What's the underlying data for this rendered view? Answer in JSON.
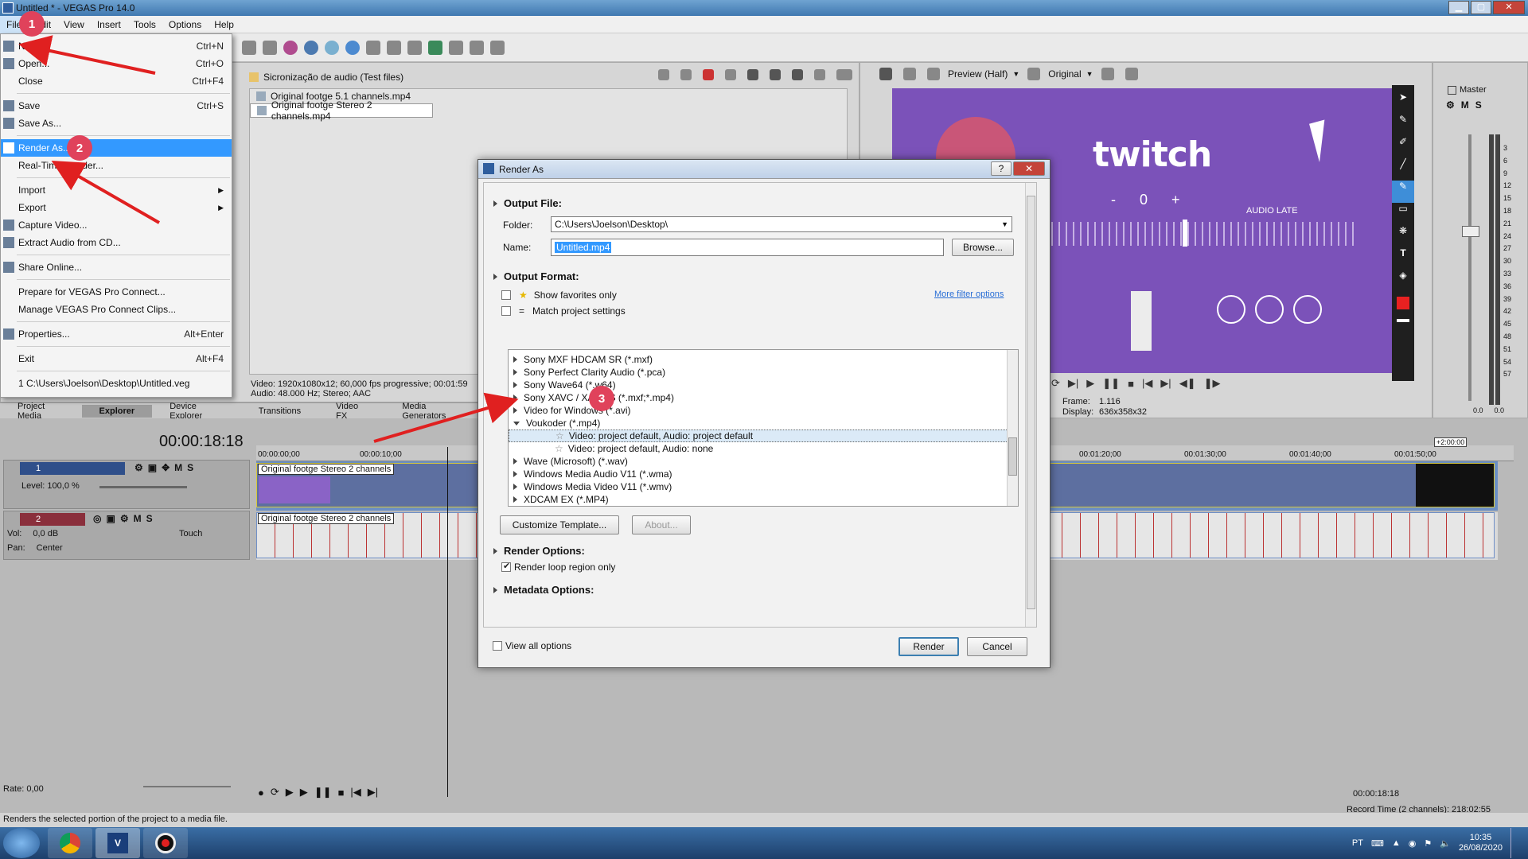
{
  "window": {
    "title": "Untitled * - VEGAS Pro 14.0"
  },
  "menubar": {
    "items": [
      "File",
      "Edit",
      "View",
      "Insert",
      "Tools",
      "Options",
      "Help"
    ]
  },
  "file_menu": {
    "items": [
      {
        "label": "New...",
        "shortcut": "Ctrl+N",
        "icon": "new-icon"
      },
      {
        "label": "Open...",
        "shortcut": "Ctrl+O",
        "icon": "open-icon"
      },
      {
        "label": "Close",
        "shortcut": "Ctrl+F4"
      },
      {
        "sep": true
      },
      {
        "label": "Save",
        "shortcut": "Ctrl+S",
        "icon": "save-icon"
      },
      {
        "label": "Save As...",
        "shortcut": "",
        "icon": "save-as-icon"
      },
      {
        "sep": true
      },
      {
        "label": "Render As...",
        "shortcut": "",
        "icon": "render-icon",
        "selected": true
      },
      {
        "label": "Real-Time Render...",
        "shortcut": ""
      },
      {
        "sep": true
      },
      {
        "label": "Import",
        "shortcut": "",
        "submenu": true
      },
      {
        "label": "Export",
        "shortcut": "",
        "submenu": true
      },
      {
        "label": "Capture Video...",
        "shortcut": "",
        "icon": "capture-icon"
      },
      {
        "label": "Extract Audio from CD...",
        "shortcut": "",
        "icon": "cd-icon"
      },
      {
        "sep": true
      },
      {
        "label": "Share Online...",
        "shortcut": "",
        "icon": "share-icon"
      },
      {
        "sep": true
      },
      {
        "label": "Prepare for VEGAS Pro Connect...",
        "shortcut": ""
      },
      {
        "label": "Manage VEGAS Pro Connect Clips...",
        "shortcut": ""
      },
      {
        "sep": true
      },
      {
        "label": "Properties...",
        "shortcut": "Alt+Enter",
        "icon": "properties-icon"
      },
      {
        "sep": true
      },
      {
        "label": "Exit",
        "shortcut": "Alt+F4"
      },
      {
        "sep": true
      },
      {
        "label": "1 C:\\Users\\Joelson\\Desktop\\Untitled.veg",
        "shortcut": ""
      }
    ]
  },
  "explorer": {
    "path": "Sicronização de audio (Test files)",
    "files": [
      "Original footge 5.1 channels.mp4",
      "Original footge Stereo 2 channels.mp4"
    ],
    "info_line1": "Video: 1920x1080x12; 60,000 fps progressive; 00:01:59",
    "info_line2": "Audio: 48.000 Hz; Stereo; AAC"
  },
  "bottom_tabs": [
    "Project Media",
    "Explorer",
    "Device Explorer",
    "Transitions",
    "Video FX",
    "Media Generators"
  ],
  "preview": {
    "mode_label": "Preview (Half)",
    "quality_label": "Original",
    "brand_text": "twitch",
    "counter": "0",
    "minus": "-",
    "plus": "+",
    "audio_late": "AUDIO LATE",
    "frame_label": "Frame:",
    "frame_value": "1.116",
    "display_label": "Display:",
    "display_value": "636x358x32"
  },
  "mixer": {
    "title": "Master",
    "m_label": "M",
    "s_label": "S",
    "scale": [
      "3",
      "6",
      "9",
      "12",
      "15",
      "18",
      "21",
      "24",
      "27",
      "30",
      "33",
      "36",
      "39",
      "42",
      "45",
      "48",
      "51",
      "54",
      "57"
    ],
    "bottom_left": "0.0",
    "bottom_right": "0.0"
  },
  "timeline": {
    "timecode": "00:00:18:18",
    "ruler": [
      "00:00:00;00",
      "00:00:10;00",
      "00:01:20;00",
      "00:01:30;00",
      "00:01:40;00",
      "00:01:50;00"
    ],
    "end_marker": "+2:00:00",
    "track1": {
      "num": "1",
      "level": "Level: 100,0 %",
      "m": "M",
      "s": "S",
      "clip": "Original footge Stereo 2 channels"
    },
    "track2": {
      "num": "2",
      "vol_label": "Vol:",
      "vol_value": "0,0 dB",
      "pan_label": "Pan:",
      "pan_value": "Center",
      "touch": "Touch",
      "m": "M",
      "s": "S",
      "clip": "Original footge Stereo 2 channels"
    },
    "rate": "Rate: 0,00",
    "time_bottom": "00:00:18:18",
    "status_left": "Renders the selected portion of the project to a media file.",
    "record_time": "Record Time (2 channels): 218:02:55"
  },
  "dialog": {
    "title": "Render As",
    "output_file_label": "Output File:",
    "folder_label": "Folder:",
    "folder_value": "C:\\Users\\Joelson\\Desktop\\",
    "name_label": "Name:",
    "name_value": "Untitled.mp4",
    "browse": "Browse...",
    "output_format_label": "Output Format:",
    "favorites": "Show favorites only",
    "match": "Match project settings",
    "more_filter": "More filter options",
    "formats": [
      {
        "label": "Sony MXF HDCAM SR (*.mxf)"
      },
      {
        "label": "Sony Perfect Clarity Audio (*.pca)"
      },
      {
        "label": "Sony Wave64 (*.w64)"
      },
      {
        "label": "Sony XAVC / XAVC S (*.mxf;*.mp4)"
      },
      {
        "label": "Video for Windows (*.avi)"
      },
      {
        "label": "Voukoder (*.mp4)",
        "expanded": true
      },
      {
        "label": "Video: project default, Audio: project default",
        "child": true,
        "highlight": true
      },
      {
        "label": "Video: project default, Audio: none",
        "child": true
      },
      {
        "label": "Wave (Microsoft) (*.wav)"
      },
      {
        "label": "Windows Media Audio V11 (*.wma)"
      },
      {
        "label": "Windows Media Video V11 (*.wmv)"
      },
      {
        "label": "XDCAM EX (*.MP4)"
      }
    ],
    "customize": "Customize Template...",
    "about": "About...",
    "render_options": "Render Options:",
    "render_loop": "Render loop region only",
    "metadata": "Metadata Options:",
    "view_all": "View all options",
    "render": "Render",
    "cancel": "Cancel"
  },
  "badges": [
    "1",
    "2",
    "3"
  ],
  "taskbar": {
    "lang": "PT",
    "time": "10:35",
    "date": "26/08/2020"
  },
  "colors": {
    "accent": "#3399ff",
    "twitch_purple": "#7b52b9",
    "badge": "#e0425b",
    "arrow": "#e02020"
  }
}
